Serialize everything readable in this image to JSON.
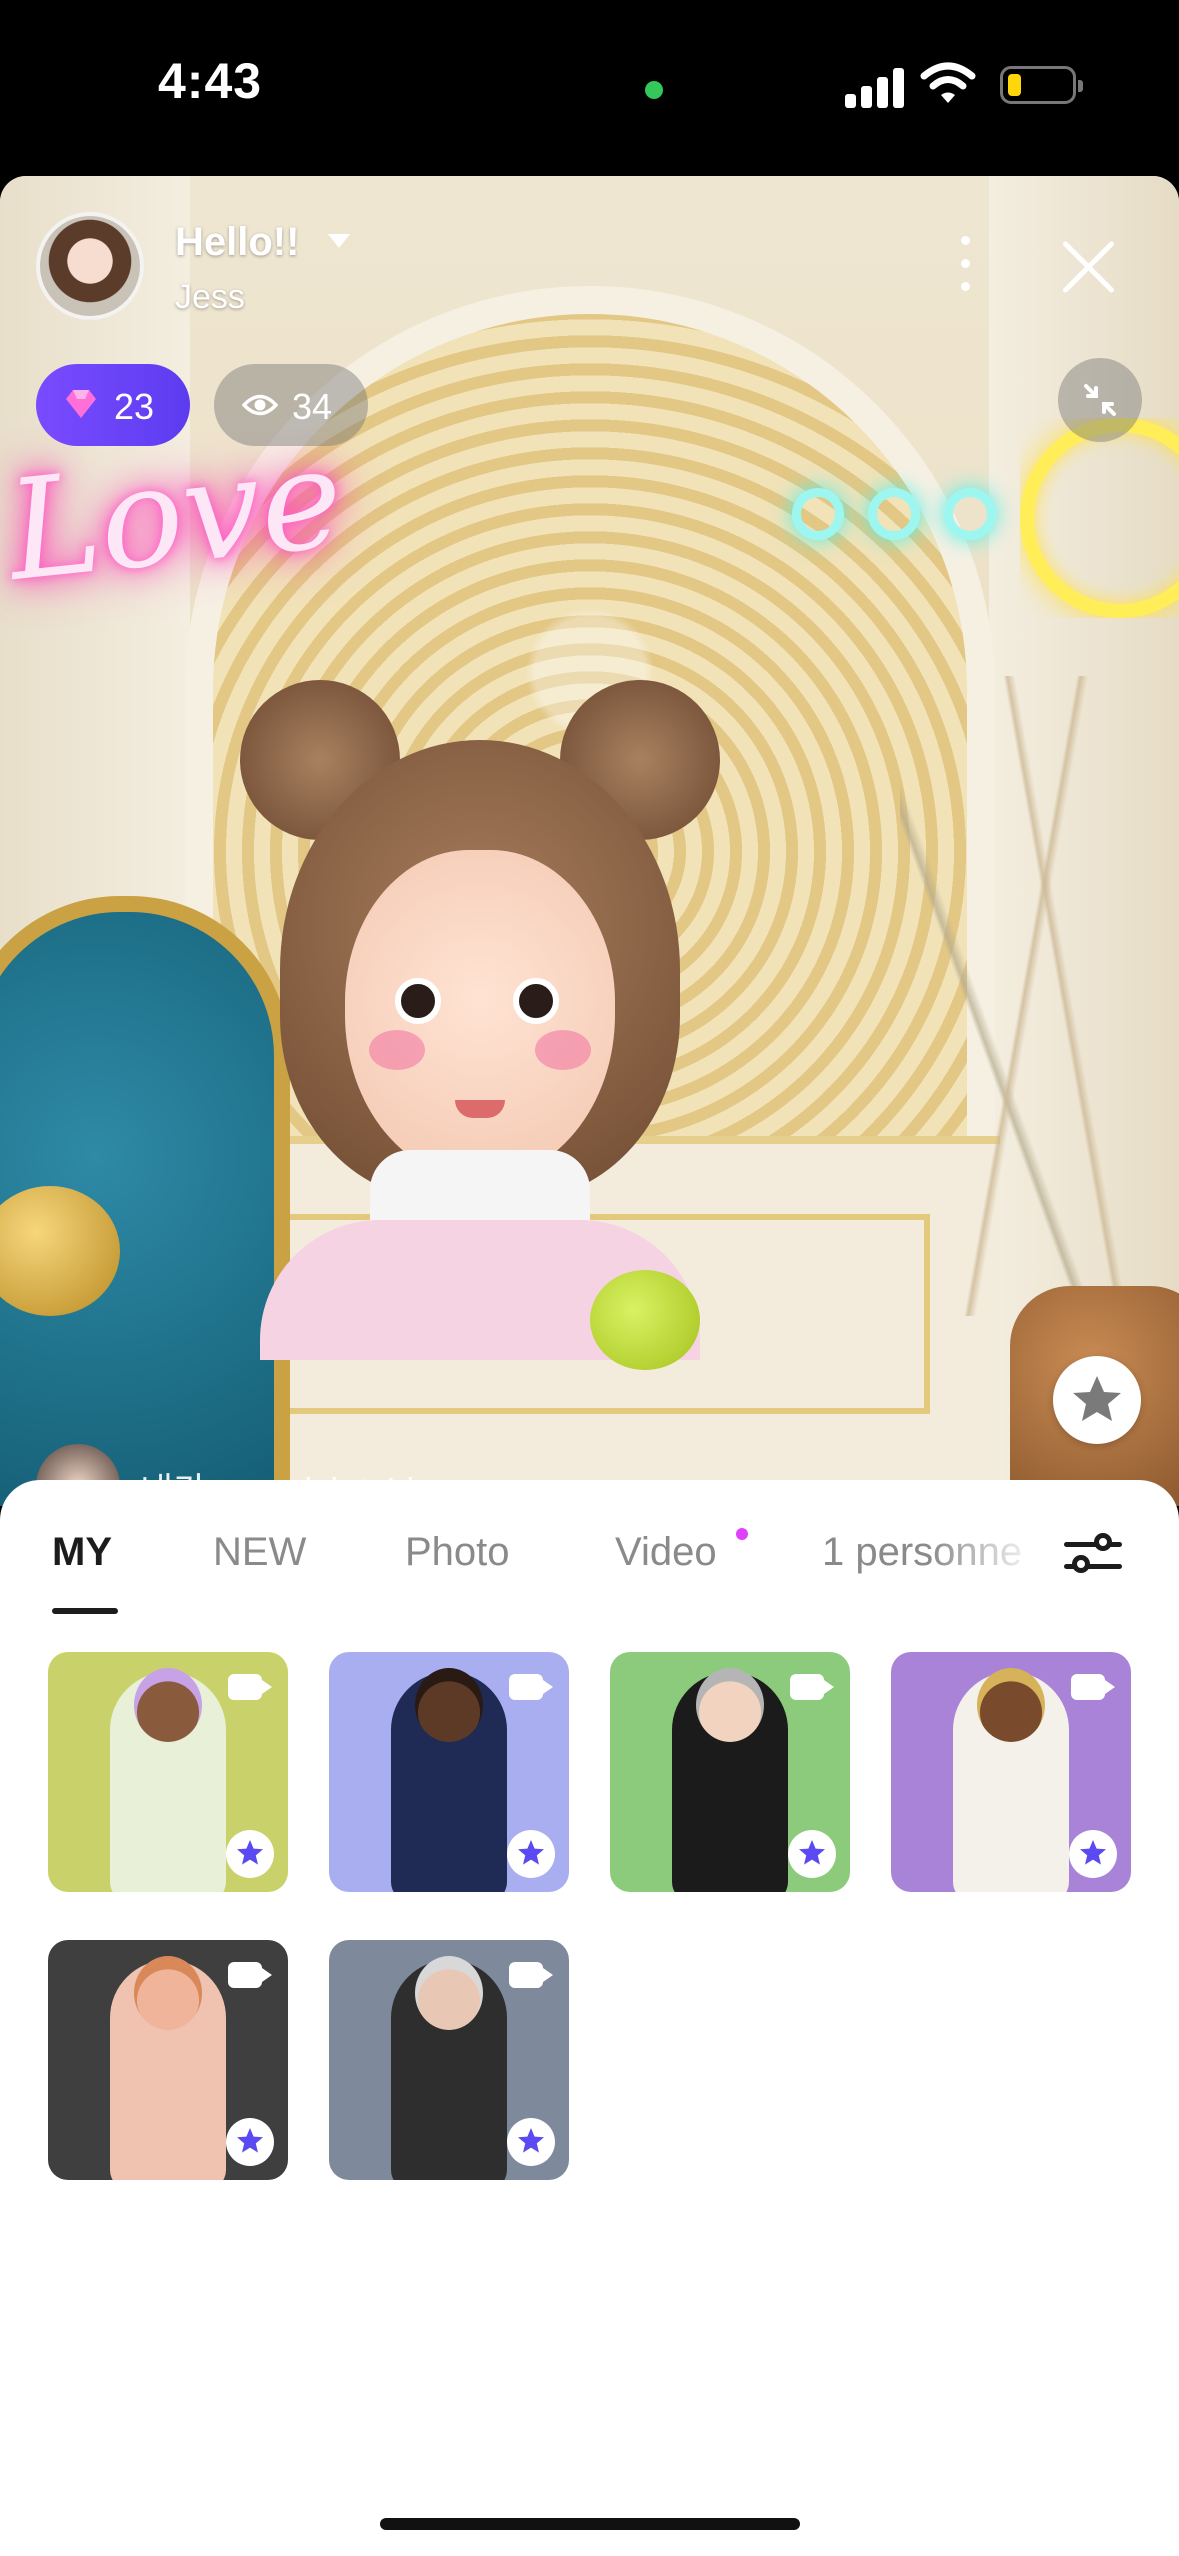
{
  "status_bar": {
    "time": "4:43",
    "privacy_dot_color": "#34c759",
    "battery_fill_color": "#ffd60a"
  },
  "live": {
    "host_title": "Hello!!",
    "host_name": "Jess",
    "gem_count": "23",
    "viewer_count": "34",
    "neon_text": "Love",
    "chat_message": "내가 maxpiciatsLive"
  },
  "tabs": {
    "items": [
      "MY",
      "NEW",
      "Photo",
      "Video",
      "1 personne"
    ],
    "active_index": 0,
    "video_dot_color": "#e040fb"
  },
  "colors": {
    "accent": "#6a3df5",
    "star": "#5b4af2"
  },
  "grid": {
    "items": [
      {
        "name": "avatar-mic-purple-hair",
        "bg": "#c9d16a",
        "skin": "#8a5a3c",
        "cloth": "#e8f0d8",
        "hair": "#c7a2e6",
        "type": "video"
      },
      {
        "name": "avatar-dj-glasses",
        "bg": "#a8aef0",
        "skin": "#5c3a26",
        "cloth": "#1f2a55",
        "hair": "#2a1a14",
        "type": "video"
      },
      {
        "name": "avatar-black-jacket",
        "bg": "#8ccb7c",
        "skin": "#f1d3bf",
        "cloth": "#1b1b1b",
        "hair": "#b5b5b5",
        "type": "video"
      },
      {
        "name": "avatar-white-outfit",
        "bg": "#a883d8",
        "skin": "#7a4a2c",
        "cloth": "#f4f1ea",
        "hair": "#d6b25a",
        "type": "video"
      },
      {
        "name": "avatar-long-curly-hair",
        "bg": "#3f3f3f",
        "skin": "#efb49a",
        "cloth": "#f0c2b0",
        "hair": "#d9885a",
        "type": "video"
      },
      {
        "name": "avatar-dj-turntable",
        "bg": "#7e8a9c",
        "skin": "#e8c8b4",
        "cloth": "#2e2e2e",
        "hair": "#d8d8d8",
        "type": "video"
      }
    ]
  }
}
